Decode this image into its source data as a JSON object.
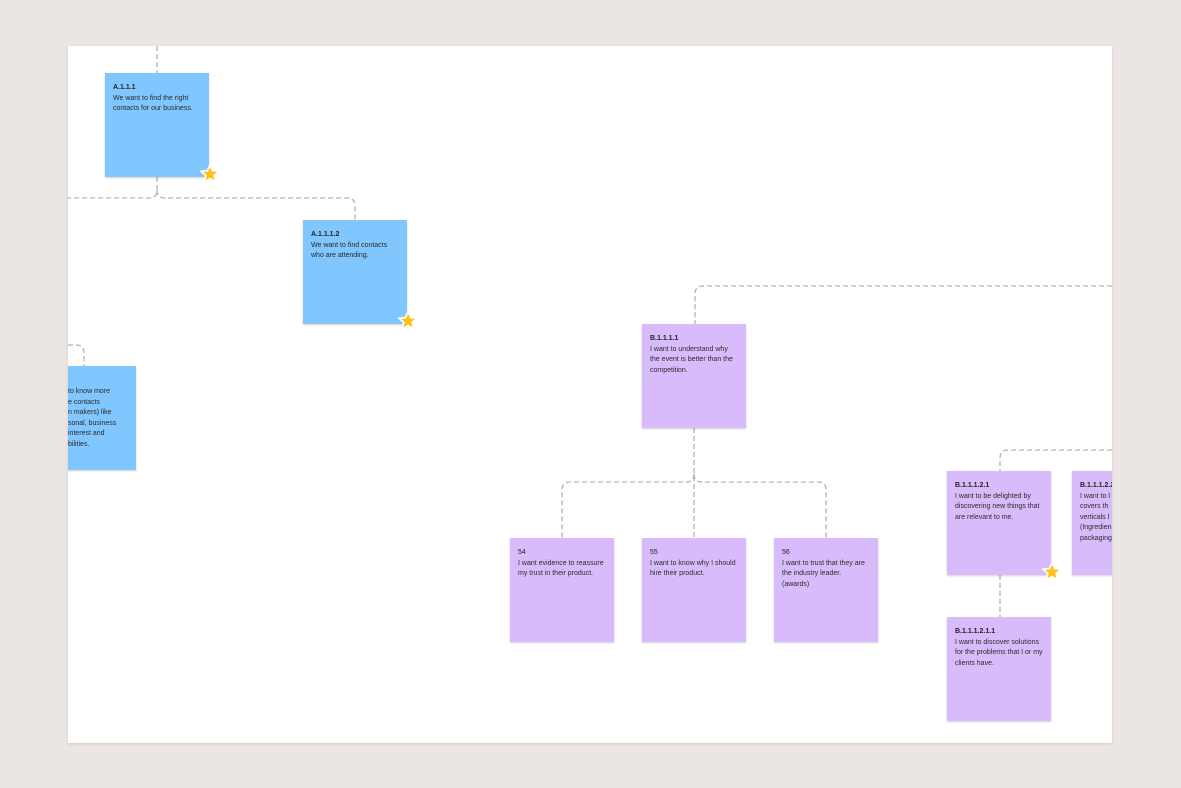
{
  "colors": {
    "canvas_background": "#ebe6e3",
    "board_background": "#ffffff",
    "sticky_blue": "#80c6ff",
    "sticky_purple": "#d8bbfb",
    "star": "#ffc21a",
    "connector": "#b3b3b3"
  },
  "stickies": {
    "a111": {
      "id": "A.1.1.1",
      "text": "We want to find the right contacts for our business."
    },
    "a1112": {
      "id": "A.1.1.1.2",
      "text": "We want to find contacts who are attending."
    },
    "a_partial": {
      "id": "",
      "text": "to know more\ne contacts\nn makers) like\nsonal, business\ninterest and\nbilities."
    },
    "b1111": {
      "id": "B.1.1.1.1",
      "text": "I want to understand why the event is better than the competition."
    },
    "n54": {
      "id": "54",
      "text": "I want evidence to reassure my trust in their product."
    },
    "n55": {
      "id": "55",
      "text": "I want to know why I should hire their product."
    },
    "n56": {
      "id": "56",
      "text": "I want to trust that they are the industry leader. (awards)"
    },
    "b11121": {
      "id": "B.1.1.1.2.1",
      "text": "I want to be delighted by discovering new things that are relevant to me."
    },
    "b11122": {
      "id": "B.1.1.1.2.2",
      "text": "I want to l\ncovers th\nverticals l\n(Ingredien\npackaging"
    },
    "b111211": {
      "id": "B.1.1.1.2.1.1",
      "text": "I want to discover solutions for the problems that I or my clients have."
    }
  },
  "icons": {
    "star": "star-icon"
  }
}
